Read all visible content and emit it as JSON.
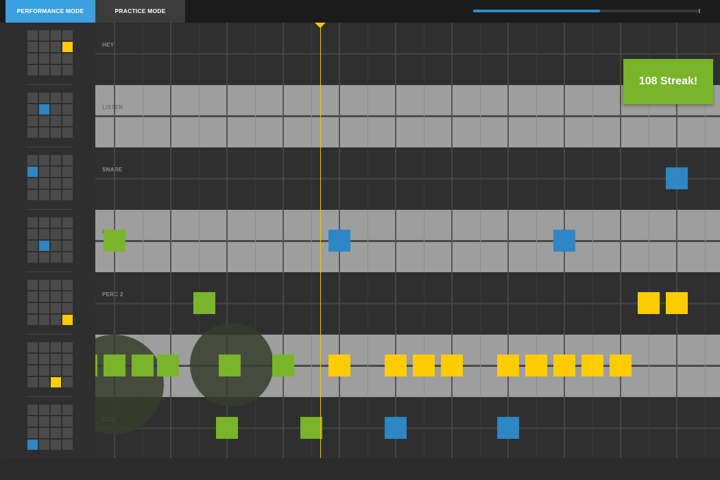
{
  "tabs": [
    {
      "label": "PERFORMANCE MODE",
      "active": true
    },
    {
      "label": "PRACTICE MODE",
      "active": false
    }
  ],
  "song_progress": 0.56,
  "streak": {
    "label": "108 Streak!"
  },
  "colors": {
    "accent_blue": "#3aa0df",
    "note_green": "#79b42a",
    "note_blue": "#2f86c4",
    "note_yellow": "#ffcc00",
    "playhead": "#f2c500"
  },
  "tracks": [
    {
      "label": "HEY",
      "pad": {
        "row": 1,
        "col": 3,
        "color": "yellow"
      }
    },
    {
      "label": "LISTEN",
      "pad": {
        "row": 1,
        "col": 1,
        "color": "blue"
      }
    },
    {
      "label": "SNARE",
      "pad": {
        "row": 1,
        "col": 0,
        "color": "blue"
      }
    },
    {
      "label": "PERC",
      "pad": {
        "row": 2,
        "col": 1,
        "color": "blue"
      }
    },
    {
      "label": "PERC 2",
      "pad": {
        "row": 3,
        "col": 3,
        "color": "yellow"
      }
    },
    {
      "label": "PERC",
      "pad": {
        "row": 3,
        "col": 2,
        "color": "yellow"
      }
    },
    {
      "label": "KICK",
      "pad": {
        "row": 3,
        "col": 0,
        "color": "blue"
      }
    }
  ],
  "notes": [
    {
      "track": 3,
      "beat": 0.0,
      "color": "green"
    },
    {
      "track": 3,
      "beat": 4.0,
      "color": "blue"
    },
    {
      "track": 3,
      "beat": 8.0,
      "color": "blue"
    },
    {
      "track": 2,
      "beat": 10.0,
      "color": "blue"
    },
    {
      "track": 4,
      "beat": 1.6,
      "color": "green"
    },
    {
      "track": 4,
      "beat": 9.5,
      "color": "yellow"
    },
    {
      "track": 4,
      "beat": 10.0,
      "color": "yellow"
    },
    {
      "track": 5,
      "beat": -0.5,
      "color": "green"
    },
    {
      "track": 5,
      "beat": 0.0,
      "color": "green"
    },
    {
      "track": 5,
      "beat": 0.5,
      "color": "green"
    },
    {
      "track": 5,
      "beat": 0.95,
      "color": "green"
    },
    {
      "track": 5,
      "beat": 2.05,
      "color": "green"
    },
    {
      "track": 5,
      "beat": 3.0,
      "color": "green"
    },
    {
      "track": 5,
      "beat": 4.0,
      "color": "yellow"
    },
    {
      "track": 5,
      "beat": 5.0,
      "color": "yellow"
    },
    {
      "track": 5,
      "beat": 5.5,
      "color": "yellow"
    },
    {
      "track": 5,
      "beat": 6.0,
      "color": "yellow"
    },
    {
      "track": 5,
      "beat": 7.0,
      "color": "yellow"
    },
    {
      "track": 5,
      "beat": 7.5,
      "color": "yellow"
    },
    {
      "track": 5,
      "beat": 8.0,
      "color": "yellow"
    },
    {
      "track": 5,
      "beat": 8.5,
      "color": "yellow"
    },
    {
      "track": 5,
      "beat": 9.0,
      "color": "yellow"
    },
    {
      "track": 6,
      "beat": 2.0,
      "color": "green"
    },
    {
      "track": 6,
      "beat": 3.5,
      "color": "green"
    },
    {
      "track": 6,
      "beat": 5.0,
      "color": "blue"
    },
    {
      "track": 6,
      "beat": 7.0,
      "color": "blue"
    }
  ]
}
